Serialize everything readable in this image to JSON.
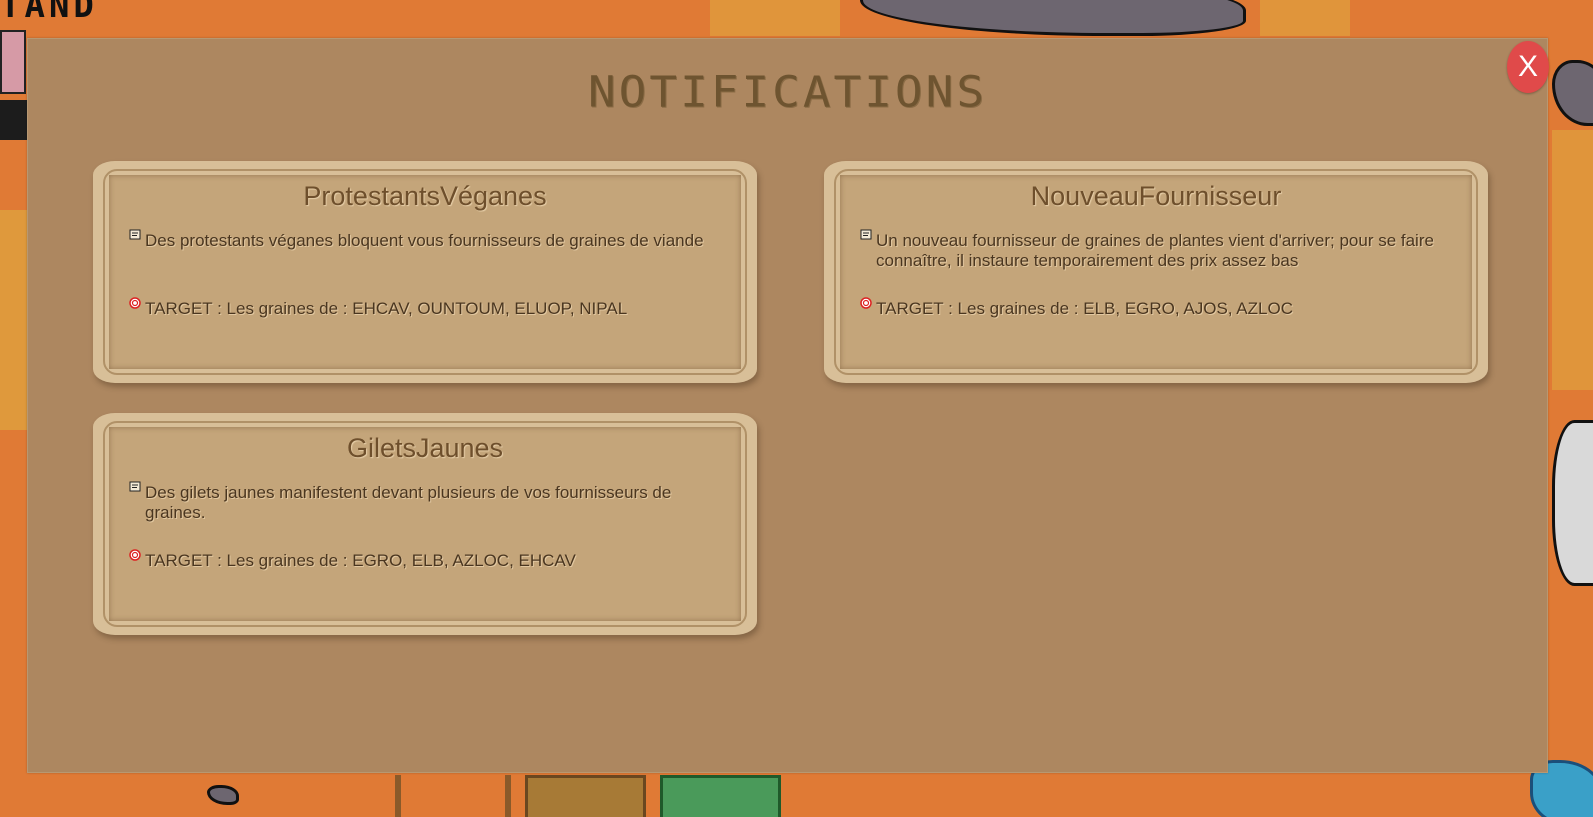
{
  "background": {
    "title_fragment": "TAND"
  },
  "modal": {
    "title": "NOTIFICATIONS",
    "close_label": "X"
  },
  "notifications": [
    {
      "title": "ProtestantsVéganes",
      "description": "Des protestants véganes bloquent vous fournisseurs de graines de viande",
      "target": "TARGET : Les graines de : EHCAV, OUNTOUM, ELUOP, NIPAL",
      "description_icon": "message-icon",
      "target_icon": "target-icon"
    },
    {
      "title": "NouveauFournisseur",
      "description": "Un nouveau fournisseur de graines de plantes vient d'arriver; pour se faire connaître, il instaure temporairement des prix assez bas",
      "target": "TARGET : Les graines de : ELB, EGRO, AJOS, AZLOC",
      "description_icon": "message-icon",
      "target_icon": "target-icon"
    },
    {
      "title": "GiletsJaunes",
      "description": "Des gilets jaunes manifestent devant plusieurs de vos fournisseurs de graines.",
      "target": "TARGET : Les graines de : EGRO, ELB, AZLOC, EHCAV",
      "description_icon": "message-icon",
      "target_icon": "target-icon"
    }
  ],
  "colors": {
    "overlay_background": "#ad8760",
    "card_background": "#c4a57a",
    "card_border": "#d8bf98",
    "close_button": "#e04a4a",
    "title_text": "#6e5430"
  }
}
